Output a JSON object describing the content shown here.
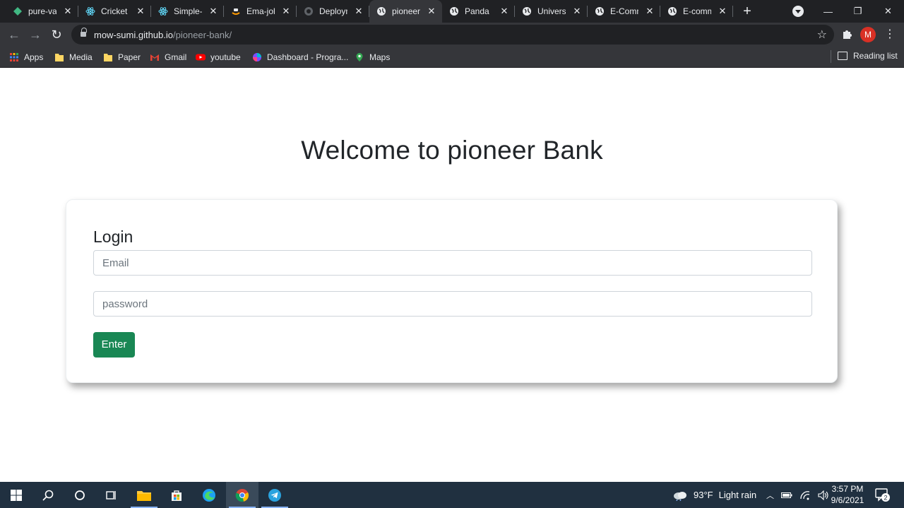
{
  "browser": {
    "tabs": [
      {
        "title": "pure-val",
        "icon": "vue-icon"
      },
      {
        "title": "Cricket T",
        "icon": "react-icon"
      },
      {
        "title": "Simple-F",
        "icon": "react-icon"
      },
      {
        "title": "Ema-joh",
        "icon": "amazon-icon"
      },
      {
        "title": "Deploym",
        "icon": "github-icon"
      },
      {
        "title": "pioneer",
        "icon": "globe-icon",
        "active": true
      },
      {
        "title": "Panda",
        "icon": "globe-icon"
      },
      {
        "title": "Universit",
        "icon": "globe-icon"
      },
      {
        "title": "E-Comm",
        "icon": "globe-icon"
      },
      {
        "title": "E-comm",
        "icon": "globe-icon"
      }
    ],
    "url_host": "mow-sumi.github.io",
    "url_path": "/pioneer-bank/",
    "profile_initial": "M",
    "bookmarks": [
      {
        "label": "Apps",
        "icon": "apps-grid-icon"
      },
      {
        "label": "Media",
        "icon": "folder-icon"
      },
      {
        "label": "Paper",
        "icon": "folder-icon"
      },
      {
        "label": "Gmail",
        "icon": "gmail-icon"
      },
      {
        "label": "youtube",
        "icon": "youtube-icon"
      },
      {
        "label": "Dashboard - Progra...",
        "icon": "dashboard-icon"
      },
      {
        "label": "Maps",
        "icon": "maps-icon"
      }
    ],
    "reading_list": "Reading list"
  },
  "page": {
    "heading": "Welcome to pioneer Bank",
    "login": {
      "title": "Login",
      "email_placeholder": "Email",
      "password_placeholder": "password",
      "submit_label": "Enter"
    }
  },
  "taskbar": {
    "weather_temp": "93°F",
    "weather_text": "Light rain",
    "time": "3:57 PM",
    "date": "9/6/2021",
    "notification_count": "2"
  },
  "colors": {
    "primary_button": "#198754",
    "heading_text": "#212529",
    "chrome_dark": "#202124",
    "chrome_toolbar": "#35363a"
  }
}
